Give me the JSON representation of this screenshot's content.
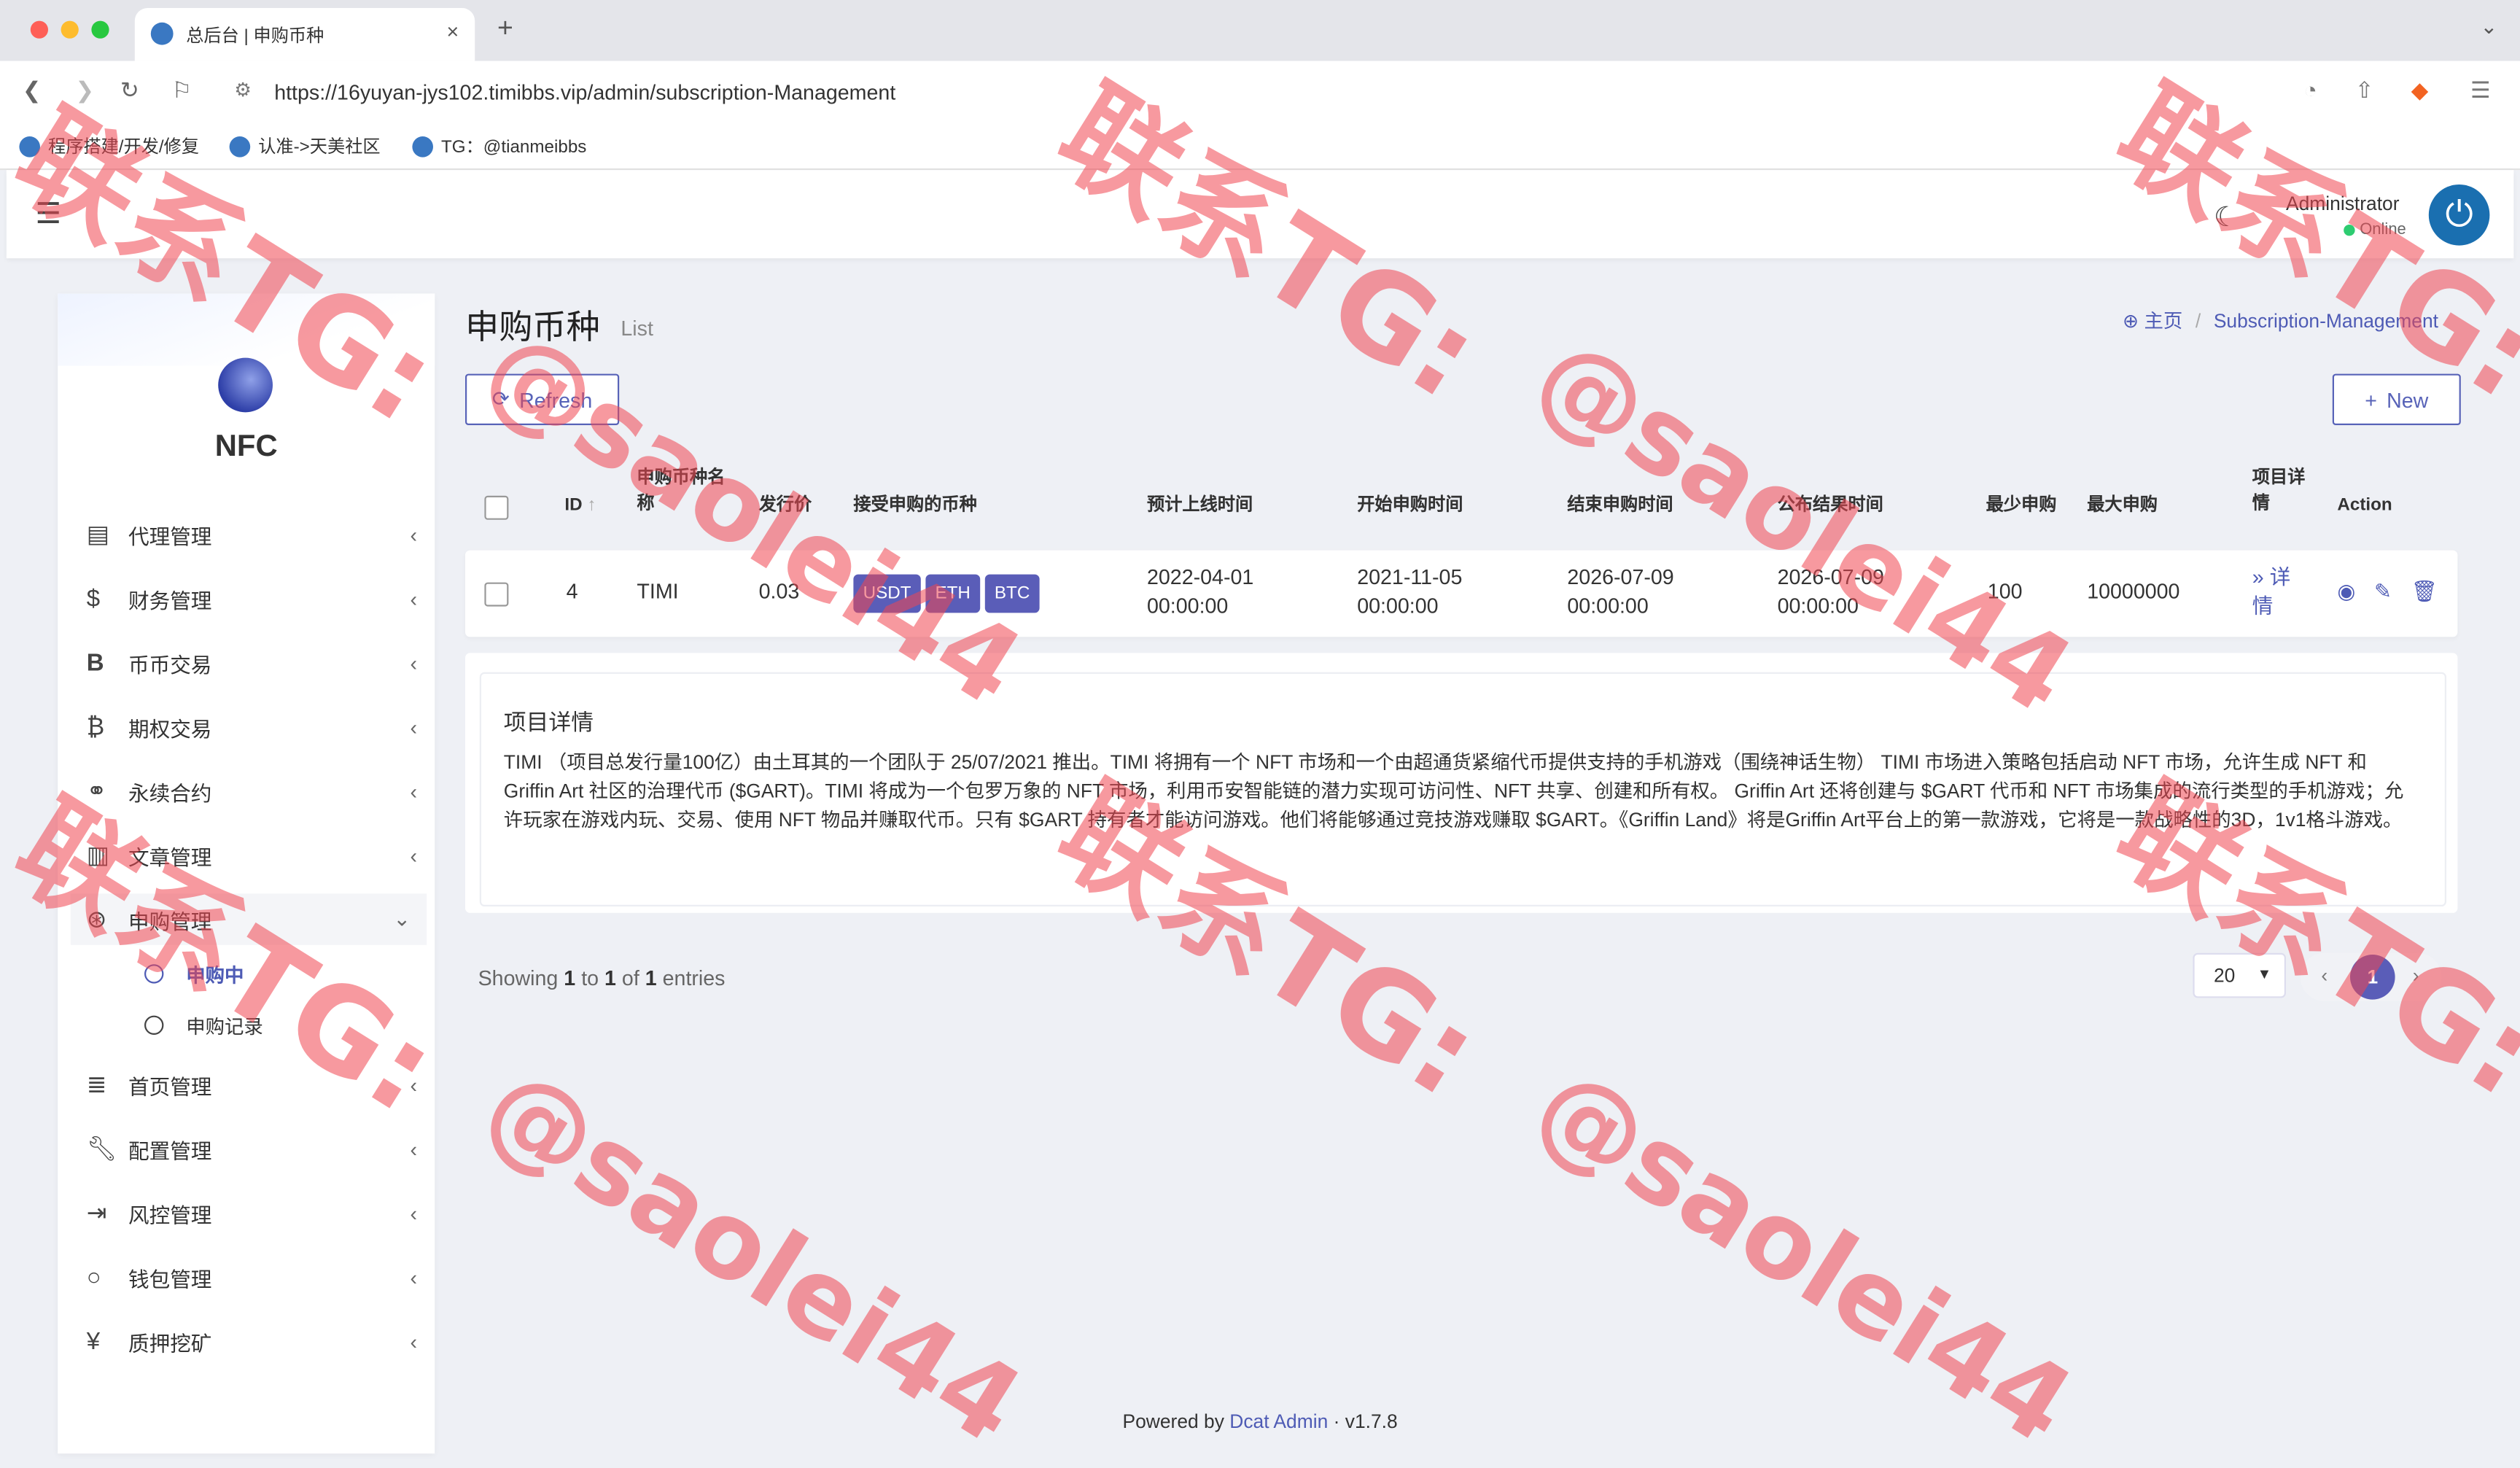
{
  "browser": {
    "tab_title": "总后台 | 申购币种",
    "tab_close": "×",
    "new_tab": "+",
    "url": "https://16yuyan-jys102.timibbs.vip/admin/subscription-Management",
    "bookmarks": [
      "程序搭建/开发/修复",
      "认准->天美社区",
      "TG：@tianmeibbs"
    ]
  },
  "navbar": {
    "admin_name": "Administrator",
    "status": "Online"
  },
  "sidebar": {
    "logo_text": "NFC",
    "items": [
      {
        "label": "代理管理",
        "icon": "id-card-icon"
      },
      {
        "label": "财务管理",
        "icon": "dollar-icon"
      },
      {
        "label": "币币交易",
        "icon": "b-icon"
      },
      {
        "label": "期权交易",
        "icon": "bitcoin-icon"
      },
      {
        "label": "永续合约",
        "icon": "link-icon"
      },
      {
        "label": "文章管理",
        "icon": "newspaper-icon"
      },
      {
        "label": "申购管理",
        "icon": "lifebuoy-icon"
      },
      {
        "label": "首页管理",
        "icon": "list-icon"
      },
      {
        "label": "配置管理",
        "icon": "wrench-icon"
      },
      {
        "label": "风控管理",
        "icon": "indent-icon"
      },
      {
        "label": "钱包管理",
        "icon": "circle-icon"
      },
      {
        "label": "质押挖矿",
        "icon": "yen-icon"
      }
    ],
    "sub_items": [
      "申购中",
      "申购记录"
    ]
  },
  "content": {
    "title": "申购币种",
    "subtitle": "List",
    "breadcrumb_home": "主页",
    "breadcrumb_current": "Subscription-Management",
    "refresh_label": "Refresh",
    "new_label": "New",
    "columns": [
      "ID",
      "申购币种名称",
      "发行价",
      "接受申购的币种",
      "预计上线时间",
      "开始申购时间",
      "结束申购时间",
      "公布结果时间",
      "最少申购",
      "最大申购",
      "项目详情",
      "Action"
    ],
    "row": {
      "id": "4",
      "name": "TIMI",
      "price": "0.03",
      "coins": [
        "USDT",
        "ETH",
        "BTC"
      ],
      "online_time": "2022-04-01 00:00:00",
      "start_time": "2021-11-05 00:00:00",
      "end_time": "2026-07-09 00:00:00",
      "result_time": "2026-07-09 00:00:00",
      "min": "100",
      "max": "10000000",
      "detail_link": "详情"
    },
    "detail_title": "项目详情",
    "detail_body": "TIMI （项目总发行量100亿）由土耳其的一个团队于 25/07/2021 推出。TIMI 将拥有一个 NFT 市场和一个由超通货紧缩代币提供支持的手机游戏（围绕神话生物） TIMI 市场进入策略包括启动 NFT 市场，允许生成 NFT 和 Griffin Art 社区的治理代币 ($GART)。TIMI 将成为一个包罗万象的 NFT 市场，利用币安智能链的潜力实现可访问性、NFT 共享、创建和所有权。 Griffin Art 还将创建与 $GART 代币和 NFT 市场集成的流行类型的手机游戏；允许玩家在游戏内玩、交易、使用 NFT 物品并赚取代币。只有 $GART 持有者才能访问游戏。他们将能够通过竞技游戏赚取 $GART。《Griffin Land》将是Griffin Art平台上的第一款游戏，它将是一款战略性的3D，1v1格斗游戏。",
    "showing_prefix": "Showing",
    "showing_from": "1",
    "showing_to_word": "to",
    "showing_to": "1",
    "showing_of_word": "of",
    "showing_total": "1",
    "showing_suffix": "entries",
    "page_size": "20",
    "current_page": "1"
  },
  "footer": {
    "prefix": "Powered by",
    "link": "Dcat Admin",
    "version": "· v1.7.8"
  },
  "watermark": {
    "line1": "联系TG:",
    "line2": "@saolei44"
  },
  "colors": {
    "accent": "#5a5db8",
    "watermark": "#f04650",
    "online": "#2ecc71"
  }
}
